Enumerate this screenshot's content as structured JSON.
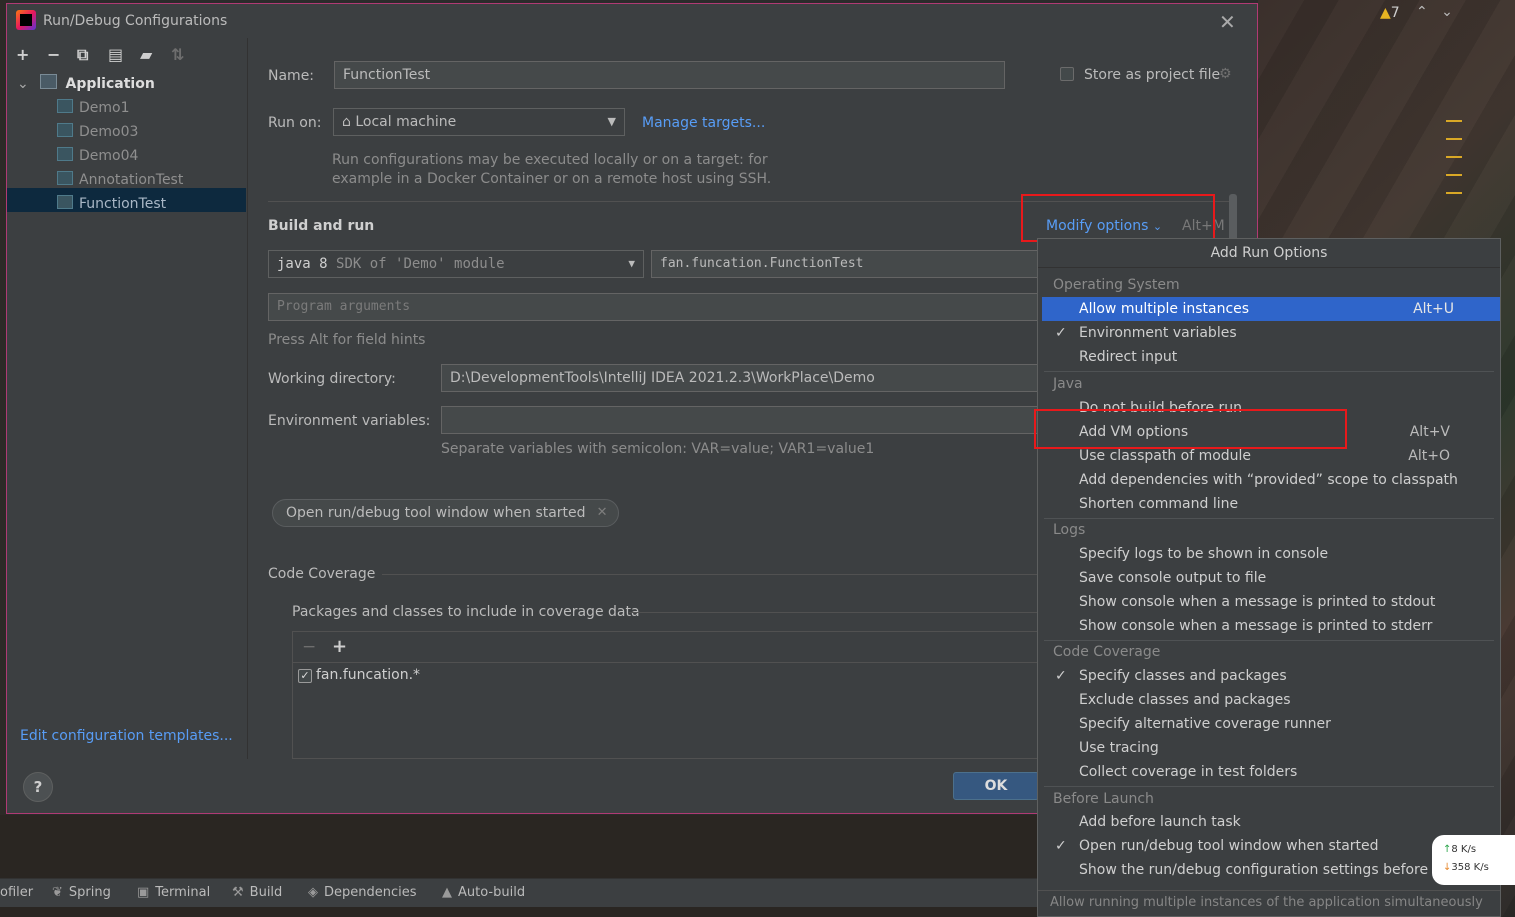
{
  "dialog": {
    "title": "Run/Debug Configurations",
    "close_icon": "close-icon",
    "toolbar_icons": [
      "plus-icon",
      "minus-icon",
      "copy-icon",
      "save-icon",
      "folder-add-icon",
      "sort-icon"
    ]
  },
  "tree": {
    "root": "Application",
    "items": [
      {
        "label": "Demo1"
      },
      {
        "label": "Demo03"
      },
      {
        "label": "Demo04"
      },
      {
        "label": "AnnotationTest"
      },
      {
        "label": "FunctionTest",
        "selected": true
      }
    ],
    "edit_templates": "Edit configuration templates..."
  },
  "form": {
    "name_label": "Name:",
    "name_value": "FunctionTest",
    "store_label": "Store as project file",
    "run_on_label": "Run on:",
    "run_on_value": "Local machine",
    "manage_targets": "Manage targets...",
    "run_on_hint_1": "Run configurations may be executed locally or on a target: for",
    "run_on_hint_2": "example in a Docker Container or on a remote host using SSH.",
    "build_and_run": "Build and run",
    "modify_options": "Modify options",
    "modify_shortcut": "Alt+M",
    "jdk_java": "java 8",
    "jdk_detail": "SDK of 'Demo' module",
    "main_class": "fan.funcation.FunctionTest",
    "program_args_placeholder": "Program arguments",
    "press_alt": "Press Alt for field hints",
    "working_dir_label": "Working directory:",
    "working_dir_value": "D:\\DevelopmentTools\\IntelliJ IDEA 2021.2.3\\WorkPlace\\Demo",
    "env_label": "Environment variables:",
    "env_value": "",
    "env_hint": "Separate variables with semicolon: VAR=value; VAR1=value1",
    "chip_label": "Open run/debug tool window when started",
    "code_coverage": "Code Coverage",
    "packages_label": "Packages and classes to include in coverage data",
    "coverage_item": "fan.funcation.*",
    "ok": "OK"
  },
  "popup": {
    "title": "Add Run Options",
    "groups": [
      {
        "name": "Operating System",
        "items": [
          {
            "label": "Allow multiple instances",
            "shortcut": "Alt+U",
            "selected": true,
            "checked": false
          },
          {
            "label": "Environment variables",
            "shortcut": "",
            "checked": true
          },
          {
            "label": "Redirect input",
            "shortcut": "",
            "checked": false
          }
        ]
      },
      {
        "name": "Java",
        "items": [
          {
            "label": "Do not build before run",
            "shortcut": "",
            "checked": false
          },
          {
            "label": "Add VM options",
            "shortcut": "Alt+V",
            "checked": false
          },
          {
            "label": "Use classpath of module",
            "shortcut": "Alt+O",
            "checked": false
          },
          {
            "label": "Add dependencies with “provided” scope to classpath",
            "shortcut": "",
            "checked": false
          },
          {
            "label": "Shorten command line",
            "shortcut": "",
            "checked": false
          }
        ]
      },
      {
        "name": "Logs",
        "items": [
          {
            "label": "Specify logs to be shown in console",
            "shortcut": "",
            "checked": false
          },
          {
            "label": "Save console output to file",
            "shortcut": "",
            "checked": false
          },
          {
            "label": "Show console when a message is printed to stdout",
            "shortcut": "",
            "checked": false
          },
          {
            "label": "Show console when a message is printed to stderr",
            "shortcut": "",
            "checked": false
          }
        ]
      },
      {
        "name": "Code Coverage",
        "items": [
          {
            "label": "Specify classes and packages",
            "shortcut": "",
            "checked": true
          },
          {
            "label": "Exclude classes and packages",
            "shortcut": "",
            "checked": false
          },
          {
            "label": "Specify alternative coverage runner",
            "shortcut": "",
            "checked": false
          },
          {
            "label": "Use tracing",
            "shortcut": "",
            "checked": false
          },
          {
            "label": "Collect coverage in test folders",
            "shortcut": "",
            "checked": false
          }
        ]
      },
      {
        "name": "Before Launch",
        "items": [
          {
            "label": "Add before launch task",
            "shortcut": "",
            "checked": false
          },
          {
            "label": "Open run/debug tool window when started",
            "shortcut": "",
            "checked": true
          },
          {
            "label": "Show the run/debug configuration settings before start",
            "shortcut": "",
            "checked": false
          }
        ]
      }
    ],
    "footer": "Allow running multiple instances of the application simultaneously"
  },
  "statusbar": {
    "items": [
      "ofiler",
      "Spring",
      "Terminal",
      "Build",
      "Dependencies",
      "Auto-build"
    ]
  },
  "topright": {
    "warning_count": "7"
  },
  "network": {
    "up": "8  K/s",
    "down": "358 K/s"
  }
}
